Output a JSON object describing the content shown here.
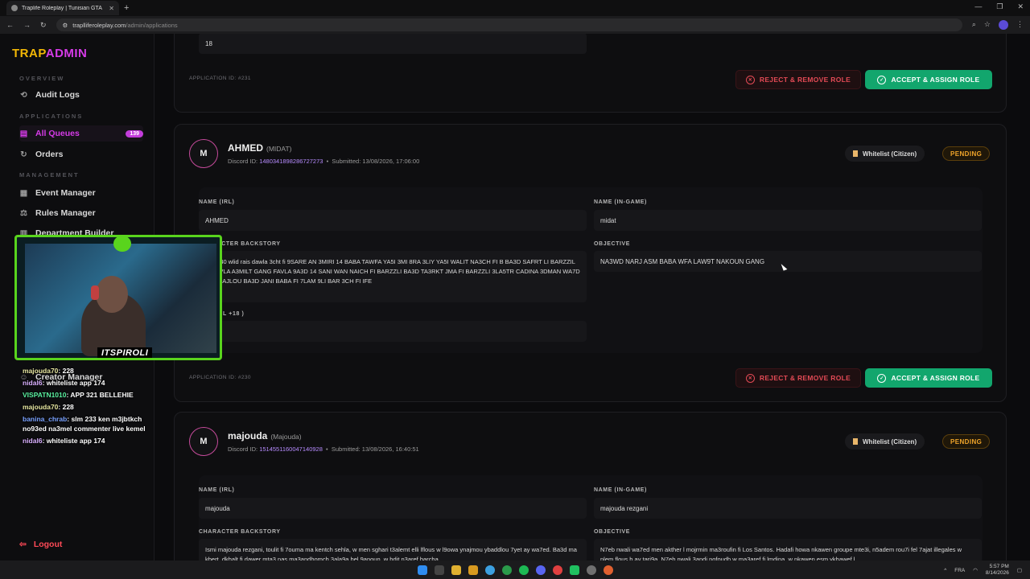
{
  "browser": {
    "tab_title": "Traplife Roleplay | Tunisian GTA",
    "url_domain": "traplliferoleplay.com",
    "url_path": "/admin/applications"
  },
  "sidebar": {
    "brand_a": "TRAP",
    "brand_b": "ADMIN",
    "sections": {
      "overview": "OVERVIEW",
      "applications": "APPLICATIONS",
      "management": "MANAGEMENT"
    },
    "items": [
      {
        "label": "Audit Logs",
        "icon": "history-icon"
      },
      {
        "label": "All Queues",
        "icon": "document-icon",
        "badge": "139"
      },
      {
        "label": "Orders",
        "icon": "refresh-icon"
      },
      {
        "label": "Event Manager",
        "icon": "calendar-icon"
      },
      {
        "label": "Rules Manager",
        "icon": "scale-icon"
      },
      {
        "label": "Department Builder",
        "icon": "building-icon"
      },
      {
        "label": "Creator Manager",
        "icon": "user-icon"
      }
    ],
    "logout": "Logout"
  },
  "prev_card": {
    "field_value": "18",
    "app_id": "APPLICATION ID: #231",
    "reject": "REJECT & REMOVE ROLE",
    "accept": "ACCEPT & ASSIGN ROLE"
  },
  "app1": {
    "initial": "M",
    "name": "AHMED",
    "alias": "(MIDAT)",
    "discord_label": "Discord ID:",
    "discord_id": "1480341898286727273",
    "submitted": "Submitted: 13/08/2026, 17:06:00",
    "tag": "Whitelist (Citizen)",
    "status": "PENDING",
    "label_name_irl": "NAME (IRL)",
    "name_irl": "AHMED",
    "label_name_ig": "NAME (IN-GAME)",
    "name_ig": "midat",
    "label_backstory": "CHARACTER BACKSTORY",
    "backstory": "3miri 40 wlid rais dawla 3cht fi 9SARE  AN 3MIRI 14 BABA TAWFA YA5I 3MI 8RA  3LIY  YA5I WALIT NA3CH FI B BA3D SAFRT LI BARZZIL FI FAVLA A3MILT GANG FAVLA  9A3D 14 SANI WAN NAICH FI BARZZLI BA3D TA3RKT JMA FI BARZZLI 3LA5TR CADINA 3DMAN WA7D MIN RAJLOU BA3D JANI BABA FI 7LAM 9LI BAR 3CH FI IFE",
    "label_objective": "OBJECTIVE",
    "objective": "NA3WD NARJ ASM BABA WFA LAW9T NAKOUN GANG",
    "label_age": "L +18 )",
    "app_id": "APPLICATION ID: #230",
    "reject": "REJECT & REMOVE ROLE",
    "accept": "ACCEPT & ASSIGN ROLE"
  },
  "app2": {
    "initial": "M",
    "name": "majouda",
    "alias": "(Majouda)",
    "discord_label": "Discord ID:",
    "discord_id": "1514551160047140928",
    "submitted": "Submitted: 13/08/2026, 16:40:51",
    "tag": "Whitelist (Citizen)",
    "status": "PENDING",
    "label_name_irl": "NAME (IRL)",
    "name_irl": "majouda",
    "label_name_ig": "NAME (IN-GAME)",
    "name_ig": "majouda rezgani",
    "label_backstory": "CHARACTER BACKSTORY",
    "backstory": "Ismi majouda rezgani, toulit fi 7ouma ma kentch sehla, w men sghari t3alemt elli lflous w l9owa ynajmou ybaddlou 7yet ay wa7ed. Ba3d ma kbert, dkhalt fi dawer mta3 nas ma3andhomch 3ala9a bel 9anoun, w bdit n3aref barcha",
    "label_objective": "OBJECTIVE",
    "objective": "N7eb nwali wa7ed men akther l mojrmin ma3roufin fi Los Santos. Hadafi howa nkawen groupe mte3i, n5adem rou7i fel 7ajat illegales w nlem flous b ay tari9a. N7eb nwali 3andi nofoudh w ma3aref fi lmdina, w nkawen esm ykhawef l"
  },
  "stream": {
    "cam_label": "ITSPIROLI",
    "chat": [
      {
        "user": "majouda70",
        "msg": ": 228"
      },
      {
        "user": "nidal6",
        "msg": ": whiteliste app 174"
      },
      {
        "user": "VISPATN1010",
        "msg": ": APP 321 BELLEHIE"
      },
      {
        "user": "majouda70",
        "msg": ": 228"
      },
      {
        "user": "banina_chrab",
        "msg": ": slm 233 ken m3jbtkch no93ed na3mel commenter live kemel"
      },
      {
        "user": "nidal6",
        "msg": ": whiteliste app 174"
      }
    ]
  },
  "taskbar": {
    "lang": "FRA",
    "time": "5:57 PM",
    "date": "8/14/2026"
  },
  "colors": {
    "brand_yellow": "#f2b705",
    "brand_pink": "#d63be8",
    "accept_green": "#12a66d",
    "reject_red": "#e24a55",
    "pending_orange": "#f0a52a"
  }
}
